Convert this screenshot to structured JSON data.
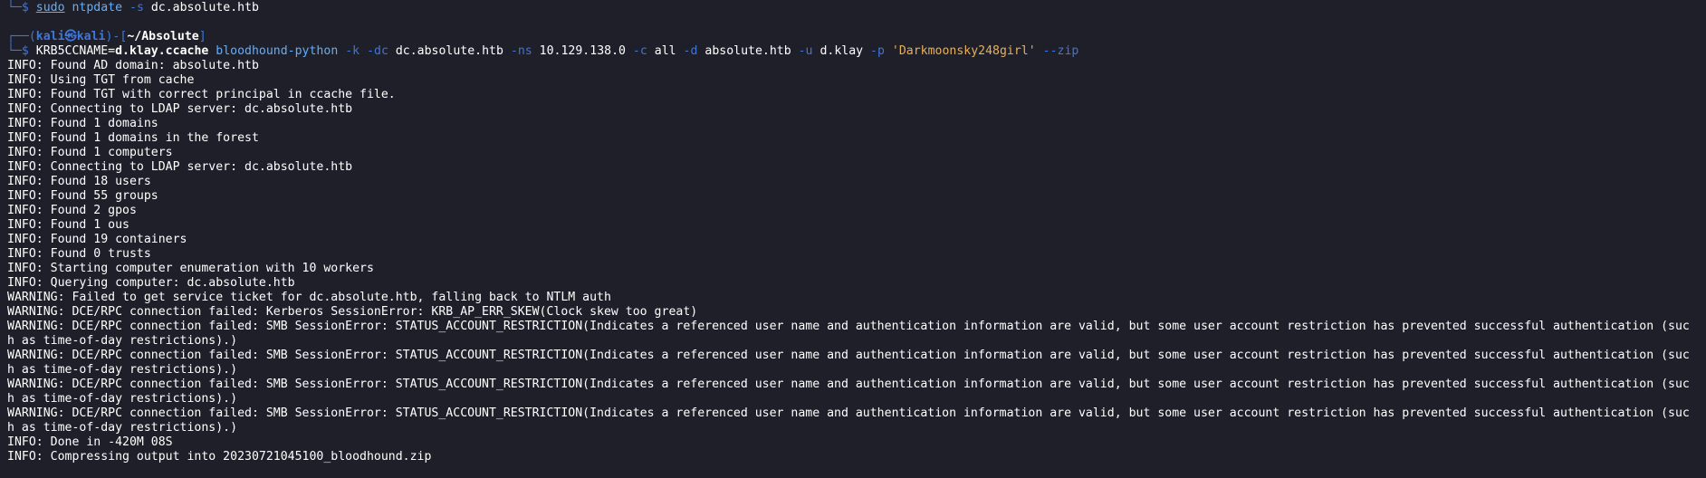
{
  "prev_command": {
    "prefix": "└─$ ",
    "sudo": "sudo",
    "cmd": "ntpdate",
    "flag": "-s",
    "arg": "dc.absolute.htb"
  },
  "prompt": {
    "open": "┌──(",
    "user_host": "kali㉿kali",
    "mid": ")-[",
    "path": "~/Absolute",
    "close": "]",
    "prefix": "└─$ "
  },
  "command": {
    "env_name": "KRB5CCNAME=",
    "env_value": "d.klay.ccache",
    "program": "bloodhound-python",
    "tokens": [
      {
        "t": "flag",
        "v": "-k"
      },
      {
        "t": "flag",
        "v": "-dc"
      },
      {
        "t": "arg",
        "v": "dc.absolute.htb"
      },
      {
        "t": "flag",
        "v": "-ns"
      },
      {
        "t": "arg",
        "v": "10.129.138.0"
      },
      {
        "t": "flag",
        "v": "-c"
      },
      {
        "t": "arg",
        "v": "all"
      },
      {
        "t": "flag",
        "v": "-d"
      },
      {
        "t": "arg",
        "v": "absolute.htb"
      },
      {
        "t": "flag",
        "v": "-u"
      },
      {
        "t": "arg",
        "v": "d.klay"
      },
      {
        "t": "flag",
        "v": "-p"
      },
      {
        "t": "quote",
        "v": "'Darkmoonsky248girl'"
      },
      {
        "t": "flag",
        "v": "--zip"
      }
    ]
  },
  "output": [
    "INFO: Found AD domain: absolute.htb",
    "INFO: Using TGT from cache",
    "INFO: Found TGT with correct principal in ccache file.",
    "INFO: Connecting to LDAP server: dc.absolute.htb",
    "INFO: Found 1 domains",
    "INFO: Found 1 domains in the forest",
    "INFO: Found 1 computers",
    "INFO: Connecting to LDAP server: dc.absolute.htb",
    "INFO: Found 18 users",
    "INFO: Found 55 groups",
    "INFO: Found 2 gpos",
    "INFO: Found 1 ous",
    "INFO: Found 19 containers",
    "INFO: Found 0 trusts",
    "INFO: Starting computer enumeration with 10 workers",
    "INFO: Querying computer: dc.absolute.htb",
    "WARNING: Failed to get service ticket for dc.absolute.htb, falling back to NTLM auth",
    "WARNING: DCE/RPC connection failed: Kerberos SessionError: KRB_AP_ERR_SKEW(Clock skew too great)",
    "WARNING: DCE/RPC connection failed: SMB SessionError: STATUS_ACCOUNT_RESTRICTION(Indicates a referenced user name and authentication information are valid, but some user account restriction has prevented successful authentication (suc",
    "h as time-of-day restrictions).)",
    "WARNING: DCE/RPC connection failed: SMB SessionError: STATUS_ACCOUNT_RESTRICTION(Indicates a referenced user name and authentication information are valid, but some user account restriction has prevented successful authentication (suc",
    "h as time-of-day restrictions).)",
    "WARNING: DCE/RPC connection failed: SMB SessionError: STATUS_ACCOUNT_RESTRICTION(Indicates a referenced user name and authentication information are valid, but some user account restriction has prevented successful authentication (suc",
    "h as time-of-day restrictions).)",
    "WARNING: DCE/RPC connection failed: SMB SessionError: STATUS_ACCOUNT_RESTRICTION(Indicates a referenced user name and authentication information are valid, but some user account restriction has prevented successful authentication (suc",
    "h as time-of-day restrictions).)",
    "INFO: Done in -420M 08S",
    "INFO: Compressing output into 20230721045100_bloodhound.zip"
  ],
  "colors": {
    "background": "#1e1f29",
    "prompt_blue": "#3f76d8",
    "command_blue": "#5fafff",
    "string_orange": "#e7b05c"
  }
}
